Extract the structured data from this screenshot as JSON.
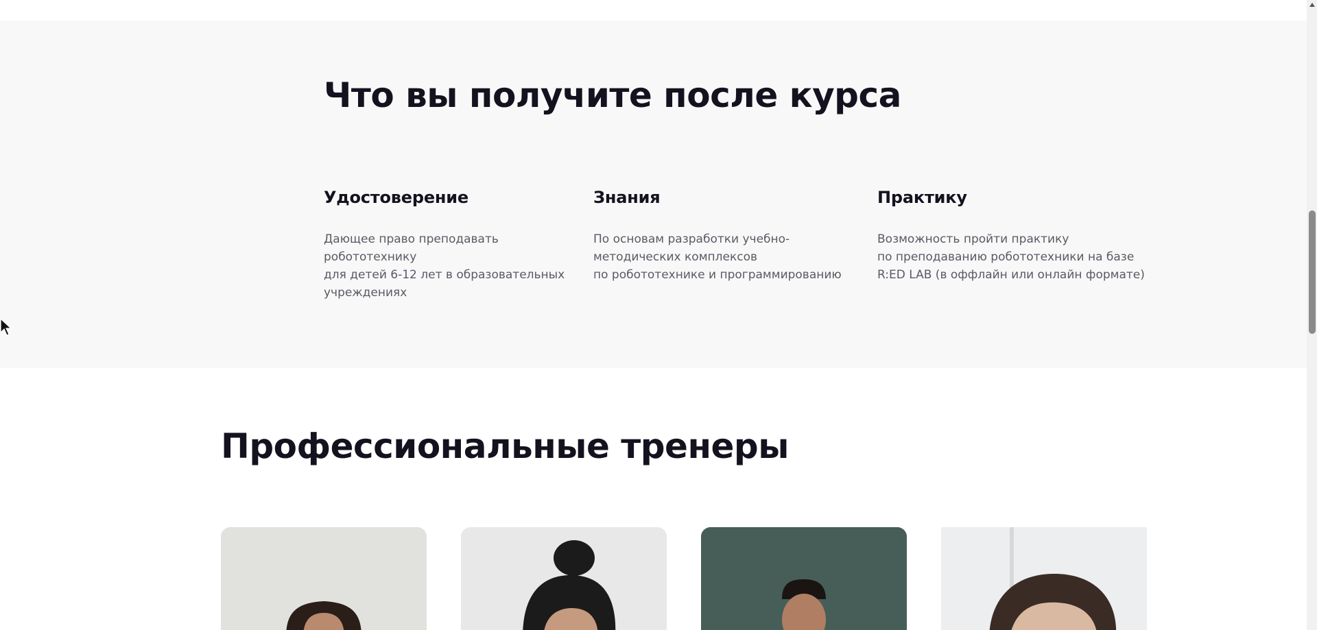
{
  "benefits": {
    "title": "Что вы получите после курса",
    "items": [
      {
        "title": "Удостоверение",
        "text": "Дающее право преподавать робототехнику\nдля детей 6-12 лет в образовательных\nучреждениях"
      },
      {
        "title": "Знания",
        "text": "По основам разработки учебно-\nметодических комплексов\nпо робототехнике и программированию"
      },
      {
        "title": "Практику",
        "text": "Возможность пройти практику\nпо преподаванию робототехники на базе\nR:ED LAB (в оффлайн или онлайн формате)"
      }
    ]
  },
  "trainers": {
    "title": "Профессиональные тренеры"
  },
  "colors": {
    "heading": "#15121f",
    "body_text": "#5b5963",
    "section_bg": "#f8f8f8"
  }
}
